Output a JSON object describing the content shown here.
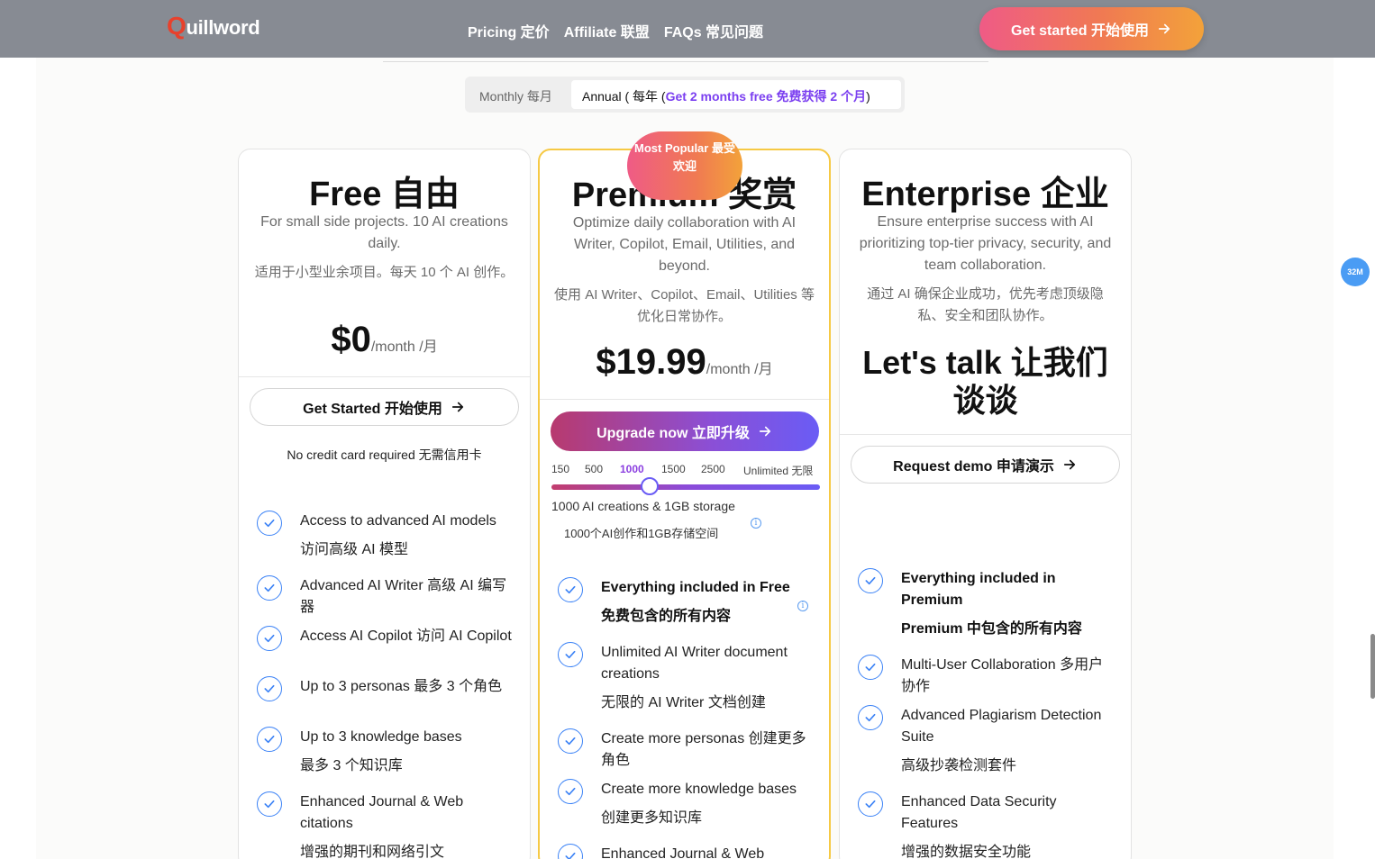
{
  "header": {
    "logo_q": "Q",
    "logo_rest": "uillword",
    "nav": [
      {
        "label": "Pricing  定价"
      },
      {
        "label": "Affiliate  联盟"
      },
      {
        "label": "FAQs  常见问题"
      }
    ],
    "cta": "Get started  开始使用"
  },
  "billing_toggle": {
    "monthly": "Monthly  每月",
    "annual_prefix": "Annual (  每年  (",
    "annual_promo": "Get 2 months free  免费获得 2 个月",
    "annual_suffix": ")"
  },
  "plans": {
    "free": {
      "title": "Free  自由",
      "desc_en": "For small side projects. 10 AI creations daily.",
      "desc_cn": "适用于小型业余项目。每天 10 个 AI 创作。",
      "price": "$0",
      "per": "/month  /月",
      "button": "Get Started  开始使用",
      "note": "No credit card required  无需信用卡",
      "features": [
        {
          "text": "Access to advanced AI models",
          "sub": "访问高级 AI 模型"
        },
        {
          "text": "Advanced AI Writer  高级 AI 编写器",
          "sub": ""
        },
        {
          "text": "Access AI Copilot  访问 AI Copilot",
          "sub": ""
        },
        {
          "text": "Up to 3 personas  最多 3 个角色",
          "sub": ""
        },
        {
          "text": "Up to 3 knowledge bases",
          "sub": "最多 3 个知识库"
        },
        {
          "text": "Enhanced Journal & Web citations",
          "sub": "增强的期刊和网络引文"
        }
      ]
    },
    "premium": {
      "badge": "Most Popular  最受欢迎",
      "title": "Premium  奖赏",
      "desc_en": "Optimize daily collaboration with AI Writer, Copilot, Email, Utilities, and beyond.",
      "desc_cn": "使用 AI Writer、Copilot、Email、Utilities 等优化日常协作。",
      "price": "$19.99",
      "per": "/month  /月",
      "button": "Upgrade now  立即升级",
      "slider": {
        "ticks": [
          "150",
          "500",
          "1000",
          "1500",
          "2500",
          "Unlimited  无限"
        ],
        "selected": "1000",
        "caption": "1000 AI creations & 1GB storage",
        "caption_cn": "1000个AI创作和1GB存储空间"
      },
      "features": [
        {
          "text": "Everything included in Free",
          "sub": "免费包含的所有内容",
          "bold": true
        },
        {
          "text": "Unlimited AI Writer document creations",
          "sub": "无限的 AI Writer 文档创建"
        },
        {
          "text": "Create more personas  创建更多角色",
          "sub": ""
        },
        {
          "text": "Create more knowledge bases",
          "sub": "创建更多知识库"
        },
        {
          "text": "Enhanced Journal & Web",
          "sub": ""
        }
      ]
    },
    "enterprise": {
      "title": "Enterprise  企业",
      "desc_en": "Ensure enterprise success with AI prioritizing top-tier privacy, security, and team collaboration.",
      "desc_cn": "通过 AI 确保企业成功，优先考虑顶级隐私、安全和团队协作。",
      "price_text": "Let's talk  让我们谈谈",
      "button": "Request demo  申请演示",
      "features": [
        {
          "text": "Everything included in Premium",
          "sub": "Premium 中包含的所有内容",
          "bold": true
        },
        {
          "text": "Multi-User Collaboration  多用户协作",
          "sub": ""
        },
        {
          "text": "Advanced Plagiarism Detection Suite",
          "sub": "高级抄袭检测套件"
        },
        {
          "text": "Enhanced Data Security Features",
          "sub": "增强的数据安全功能"
        }
      ]
    }
  },
  "scroll_badge": "32M",
  "colors": {
    "header_bg": "#878b93",
    "accent_orange": "#f07a52",
    "accent_purple": "#7b3ff0",
    "check_blue": "#3b82f6",
    "premium_border": "#f6c944"
  }
}
